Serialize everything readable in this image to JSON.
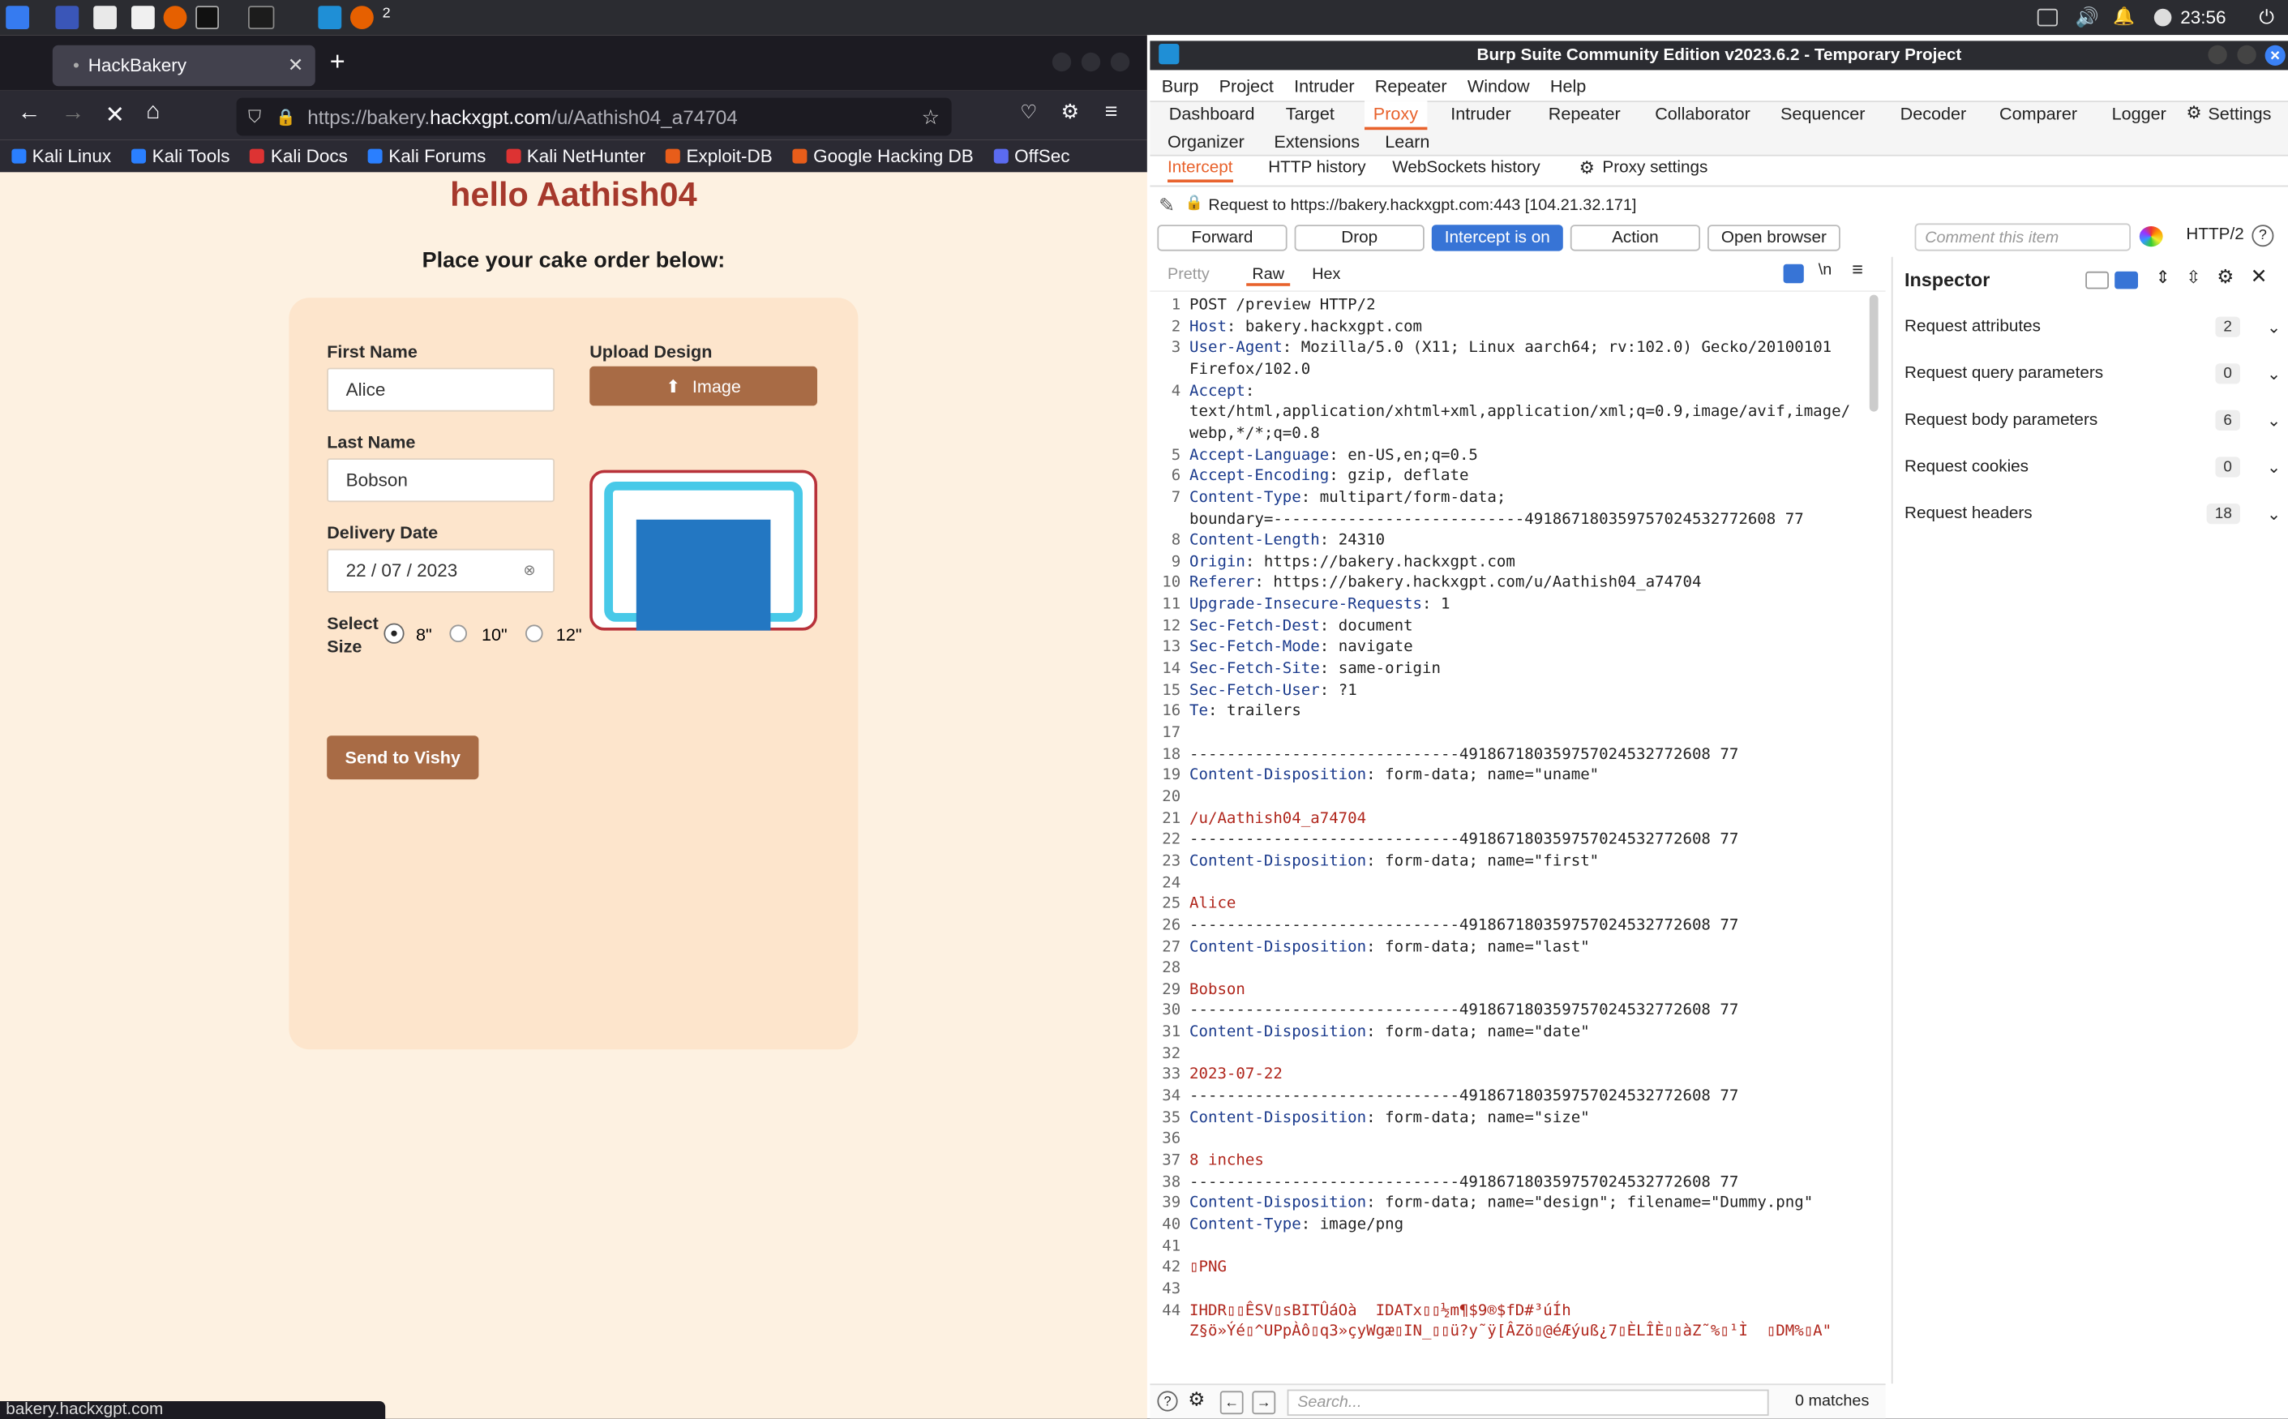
{
  "taskbar": {
    "clock": "23:56",
    "badge": "2"
  },
  "firefox": {
    "tab_title": "HackBakery",
    "url_prefix": "https://bakery.",
    "url_domain": "hackxgpt.com",
    "url_path": "/u/Aathish04_a74704",
    "bookmarks": [
      "Kali Linux",
      "Kali Tools",
      "Kali Docs",
      "Kali Forums",
      "Kali NetHunter",
      "Exploit-DB",
      "Google Hacking DB",
      "OffSec"
    ],
    "status_url": "bakery.hackxgpt.com"
  },
  "page": {
    "greeting": "hello Aathish04",
    "subtitle": "Place your cake order below:",
    "first_name_label": "First Name",
    "first_name_value": "Alice",
    "last_name_label": "Last Name",
    "last_name_value": "Bobson",
    "delivery_label": "Delivery Date",
    "delivery_value": "22 / 07 / 2023",
    "size_label_1": "Select",
    "size_label_2": "Size",
    "sizes": [
      "8\"",
      "10\"",
      "12\""
    ],
    "upload_label": "Upload Design",
    "upload_button": "Image",
    "submit": "Send to Vishy"
  },
  "burp": {
    "title": "Burp Suite Community Edition v2023.6.2 - Temporary Project",
    "menu": [
      "Burp",
      "Project",
      "Intruder",
      "Repeater",
      "Window",
      "Help"
    ],
    "tabs_row1": [
      "Dashboard",
      "Target",
      "Proxy",
      "Intruder",
      "Repeater",
      "Collaborator",
      "Sequencer",
      "Decoder",
      "Comparer",
      "Logger",
      "Settings"
    ],
    "tabs_row2": [
      "Organizer",
      "Extensions",
      "Learn"
    ],
    "subtabs": [
      "Intercept",
      "HTTP history",
      "WebSockets history",
      "Proxy settings"
    ],
    "request_to": "Request to https://bakery.hackxgpt.com:443  [104.21.32.171]",
    "buttons": {
      "forward": "Forward",
      "drop": "Drop",
      "intercept": "Intercept is on",
      "action": "Action",
      "open_browser": "Open browser"
    },
    "comment_placeholder": "Comment this item",
    "http_version": "HTTP/2",
    "view_tabs": [
      "Pretty",
      "Raw",
      "Hex"
    ],
    "search_placeholder": "Search...",
    "matches": "0 matches",
    "inspector": {
      "title": "Inspector",
      "rows": [
        {
          "label": "Request attributes",
          "count": "2"
        },
        {
          "label": "Request query parameters",
          "count": "0"
        },
        {
          "label": "Request body parameters",
          "count": "6"
        },
        {
          "label": "Request cookies",
          "count": "0"
        },
        {
          "label": "Request headers",
          "count": "18"
        }
      ]
    }
  },
  "request_lines": [
    {
      "n": "1",
      "k": "",
      "v": "POST /preview HTTP/2"
    },
    {
      "n": "2",
      "k": "Host",
      "v": "bakery.hackxgpt.com"
    },
    {
      "n": "3",
      "k": "User-Agent",
      "v": "Mozilla/5.0 (X11; Linux aarch64; rv:102.0) Gecko/20100101"
    },
    {
      "n": "",
      "k": "",
      "v": "Firefox/102.0"
    },
    {
      "n": "4",
      "k": "Accept",
      "v": ""
    },
    {
      "n": "",
      "k": "",
      "v": "text/html,application/xhtml+xml,application/xml;q=0.9,image/avif,image/"
    },
    {
      "n": "",
      "k": "",
      "v": "webp,*/*;q=0.8"
    },
    {
      "n": "5",
      "k": "Accept-Language",
      "v": "en-US,en;q=0.5"
    },
    {
      "n": "6",
      "k": "Accept-Encoding",
      "v": "gzip, deflate"
    },
    {
      "n": "7",
      "k": "Content-Type",
      "v": "multipart/form-data;"
    },
    {
      "n": "",
      "k": "",
      "v": "boundary=---------------------------491867180359757024532772608 77"
    },
    {
      "n": "8",
      "k": "Content-Length",
      "v": "24310"
    },
    {
      "n": "9",
      "k": "Origin",
      "v": "https://bakery.hackxgpt.com"
    },
    {
      "n": "10",
      "k": "Referer",
      "v": "https://bakery.hackxgpt.com/u/Aathish04_a74704"
    },
    {
      "n": "11",
      "k": "Upgrade-Insecure-Requests",
      "v": "1"
    },
    {
      "n": "12",
      "k": "Sec-Fetch-Dest",
      "v": "document"
    },
    {
      "n": "13",
      "k": "Sec-Fetch-Mode",
      "v": "navigate"
    },
    {
      "n": "14",
      "k": "Sec-Fetch-Site",
      "v": "same-origin"
    },
    {
      "n": "15",
      "k": "Sec-Fetch-User",
      "v": "?1"
    },
    {
      "n": "16",
      "k": "Te",
      "v": "trailers"
    },
    {
      "n": "17",
      "k": "",
      "v": ""
    },
    {
      "n": "18",
      "k": "",
      "v": "-----------------------------491867180359757024532772608 77"
    },
    {
      "n": "19",
      "k": "Content-Disposition",
      "v": "form-data; name=\"uname\""
    },
    {
      "n": "20",
      "k": "",
      "v": ""
    },
    {
      "n": "21",
      "k": "",
      "v": "/u/Aathish04_a74704",
      "red": true
    },
    {
      "n": "22",
      "k": "",
      "v": "-----------------------------491867180359757024532772608 77"
    },
    {
      "n": "23",
      "k": "Content-Disposition",
      "v": "form-data; name=\"first\""
    },
    {
      "n": "24",
      "k": "",
      "v": ""
    },
    {
      "n": "25",
      "k": "",
      "v": "Alice",
      "red": true
    },
    {
      "n": "26",
      "k": "",
      "v": "-----------------------------491867180359757024532772608 77"
    },
    {
      "n": "27",
      "k": "Content-Disposition",
      "v": "form-data; name=\"last\""
    },
    {
      "n": "28",
      "k": "",
      "v": ""
    },
    {
      "n": "29",
      "k": "",
      "v": "Bobson",
      "red": true
    },
    {
      "n": "30",
      "k": "",
      "v": "-----------------------------491867180359757024532772608 77"
    },
    {
      "n": "31",
      "k": "Content-Disposition",
      "v": "form-data; name=\"date\""
    },
    {
      "n": "32",
      "k": "",
      "v": ""
    },
    {
      "n": "33",
      "k": "",
      "v": "2023-07-22",
      "red": true
    },
    {
      "n": "34",
      "k": "",
      "v": "-----------------------------491867180359757024532772608 77"
    },
    {
      "n": "35",
      "k": "Content-Disposition",
      "v": "form-data; name=\"size\""
    },
    {
      "n": "36",
      "k": "",
      "v": ""
    },
    {
      "n": "37",
      "k": "",
      "v": "8 inches",
      "red": true
    },
    {
      "n": "38",
      "k": "",
      "v": "-----------------------------491867180359757024532772608 77"
    },
    {
      "n": "39",
      "k": "Content-Disposition",
      "v": "form-data; name=\"design\"; filename=\"Dummy.png\""
    },
    {
      "n": "40",
      "k": "Content-Type",
      "v": "image/png"
    },
    {
      "n": "41",
      "k": "",
      "v": ""
    },
    {
      "n": "42",
      "k": "",
      "v": "▯PNG",
      "red": true
    },
    {
      "n": "43",
      "k": "",
      "v": ""
    },
    {
      "n": "44",
      "k": "",
      "v": "IHDR▯▯ÊSV▯sBITÛáOà  IDATx▯▯½m¶$9®$fD#³úÍh",
      "red": true
    },
    {
      "n": "",
      "k": "",
      "v": "Z§ö»Ýé▯^UPpÀô▯q3»çyWgæ▯IN_▯▯ü?y˜ÿ[ÂZö▯@éÆýuß¿7▯ÈLÎÈ▯▯àZ˜%▯¹Ì  ▯DM%▯A\"",
      "red": true
    }
  ]
}
